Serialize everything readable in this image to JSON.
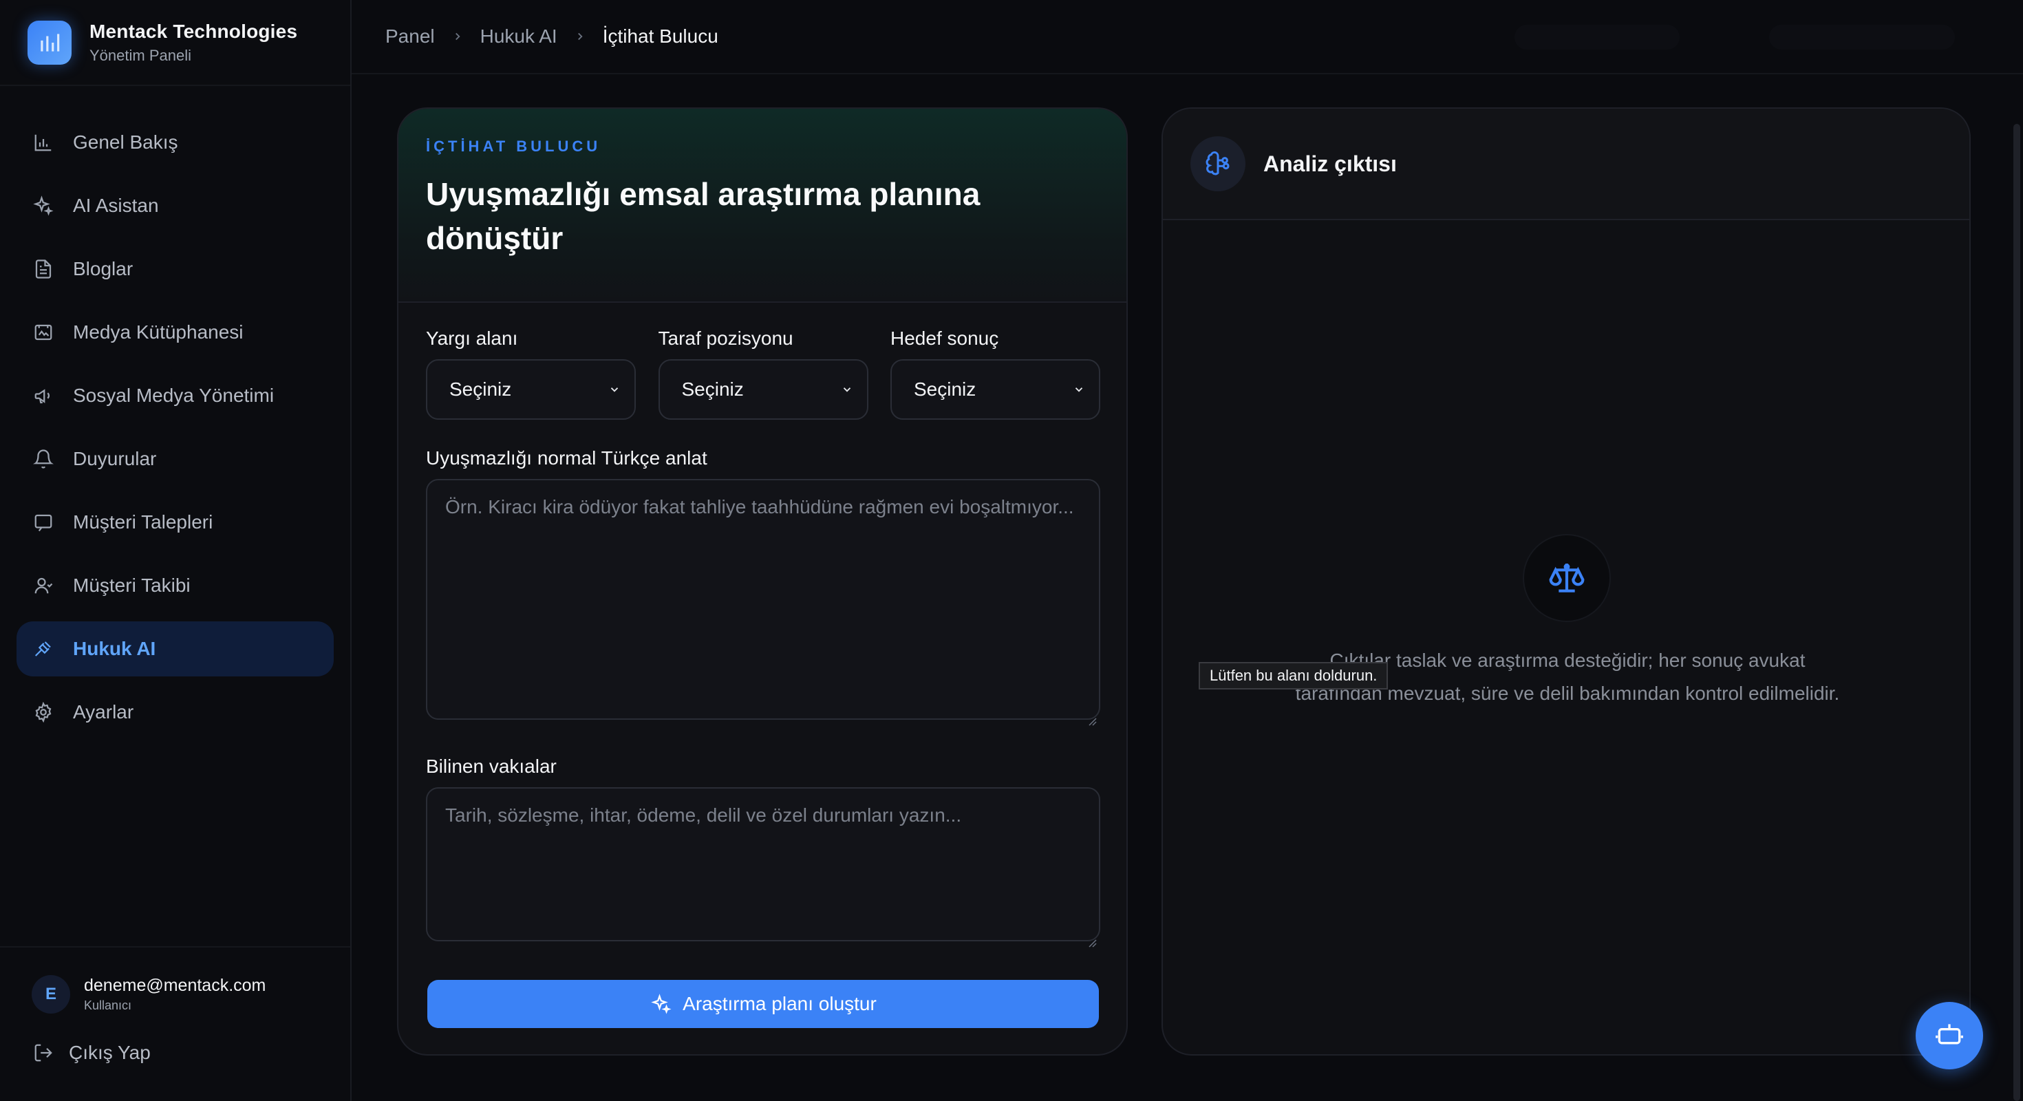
{
  "brand": {
    "name": "Mentack Technologies",
    "subtitle": "Yönetim Paneli"
  },
  "nav": {
    "items": [
      {
        "label": "Genel Bakış",
        "icon": "bar-chart-icon"
      },
      {
        "label": "AI Asistan",
        "icon": "sparkles-icon"
      },
      {
        "label": "Bloglar",
        "icon": "document-icon"
      },
      {
        "label": "Medya Kütüphanesi",
        "icon": "image-icon"
      },
      {
        "label": "Sosyal Medya Yönetimi",
        "icon": "megaphone-icon"
      },
      {
        "label": "Duyurular",
        "icon": "bell-icon"
      },
      {
        "label": "Müşteri Talepleri",
        "icon": "message-icon"
      },
      {
        "label": "Müşteri Takibi",
        "icon": "user-icon"
      },
      {
        "label": "Hukuk AI",
        "icon": "gavel-icon",
        "active": true
      },
      {
        "label": "Ayarlar",
        "icon": "gear-icon"
      }
    ]
  },
  "user": {
    "initial": "E",
    "email": "deneme@mentack.com",
    "role": "Kullanıcı"
  },
  "logout_label": "Çıkış Yap",
  "breadcrumb": [
    "Panel",
    "Hukuk AI",
    "İçtihat Bulucu"
  ],
  "form": {
    "eyebrow": "İÇTİHAT BULUCU",
    "title": "Uyuşmazlığı emsal araştırma planına dönüştür",
    "fields": [
      {
        "label": "Yargı alanı",
        "value": "Seçiniz"
      },
      {
        "label": "Taraf pozisyonu",
        "value": "Seçiniz"
      },
      {
        "label": "Hedef sonuç",
        "value": "Seçiniz"
      }
    ],
    "dispute_label": "Uyuşmazlığı normal Türkçe anlat",
    "dispute_placeholder": "Örn. Kiracı kira ödüyor fakat tahliye taahhüdüne rağmen evi boşaltmıyor...",
    "facts_label": "Bilinen vakıalar",
    "facts_placeholder": "Tarih, sözleşme, ihtar, ödeme, delil ve özel durumları yazın...",
    "submit_label": "Araştırma planı oluştur"
  },
  "output": {
    "title": "Analiz çıktısı",
    "empty_text": "Çıktılar taslak ve araştırma desteğidir; her sonuç avukat tarafından mevzuat, süre ve delil bakımından kontrol edilmelidir."
  },
  "tooltip": "Lütfen bu alanı doldurun.",
  "colors": {
    "accent": "#3b82f6",
    "background": "#0a0b0f"
  }
}
